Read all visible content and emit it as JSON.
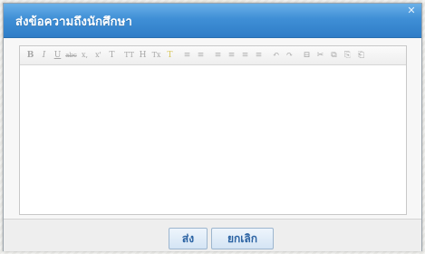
{
  "dialog": {
    "title": "ส่งข้อความถึงนักศึกษา",
    "close_icon": "close-icon"
  },
  "toolbar": {
    "buttons": [
      {
        "name": "bold-button",
        "glyph": "B"
      },
      {
        "name": "italic-button",
        "glyph": "I"
      },
      {
        "name": "underline-button",
        "glyph": "U"
      },
      {
        "name": "strikethrough-button",
        "glyph": "abc"
      },
      {
        "name": "subscript-button",
        "glyph": "x,"
      },
      {
        "name": "superscript-button",
        "glyph": "x'"
      },
      {
        "name": "font-size-button",
        "glyph": "T"
      },
      {
        "name": "font-family-button",
        "glyph": "TT"
      },
      {
        "name": "heading-button",
        "glyph": "H"
      },
      {
        "name": "clear-format-button",
        "glyph": "Tx"
      },
      {
        "name": "highlight-button",
        "glyph": "T"
      },
      {
        "name": "bullet-list-button",
        "glyph": "≡"
      },
      {
        "name": "numbered-list-button",
        "glyph": "≡"
      },
      {
        "name": "align-left-button",
        "glyph": "≡"
      },
      {
        "name": "align-center-button",
        "glyph": "≡"
      },
      {
        "name": "align-right-button",
        "glyph": "≡"
      },
      {
        "name": "justify-button",
        "glyph": "≡"
      },
      {
        "name": "undo-button",
        "glyph": "↶"
      },
      {
        "name": "redo-button",
        "glyph": "↷"
      },
      {
        "name": "link-button",
        "glyph": "⊟"
      },
      {
        "name": "cut-button",
        "glyph": "✂"
      },
      {
        "name": "copy-button",
        "glyph": "⧉"
      },
      {
        "name": "paste-button",
        "glyph": "⎘"
      },
      {
        "name": "paste-text-button",
        "glyph": "⎗"
      }
    ]
  },
  "editor": {
    "content": ""
  },
  "footer": {
    "send_label": "ส่ง",
    "cancel_label": "ยกเลิก"
  }
}
